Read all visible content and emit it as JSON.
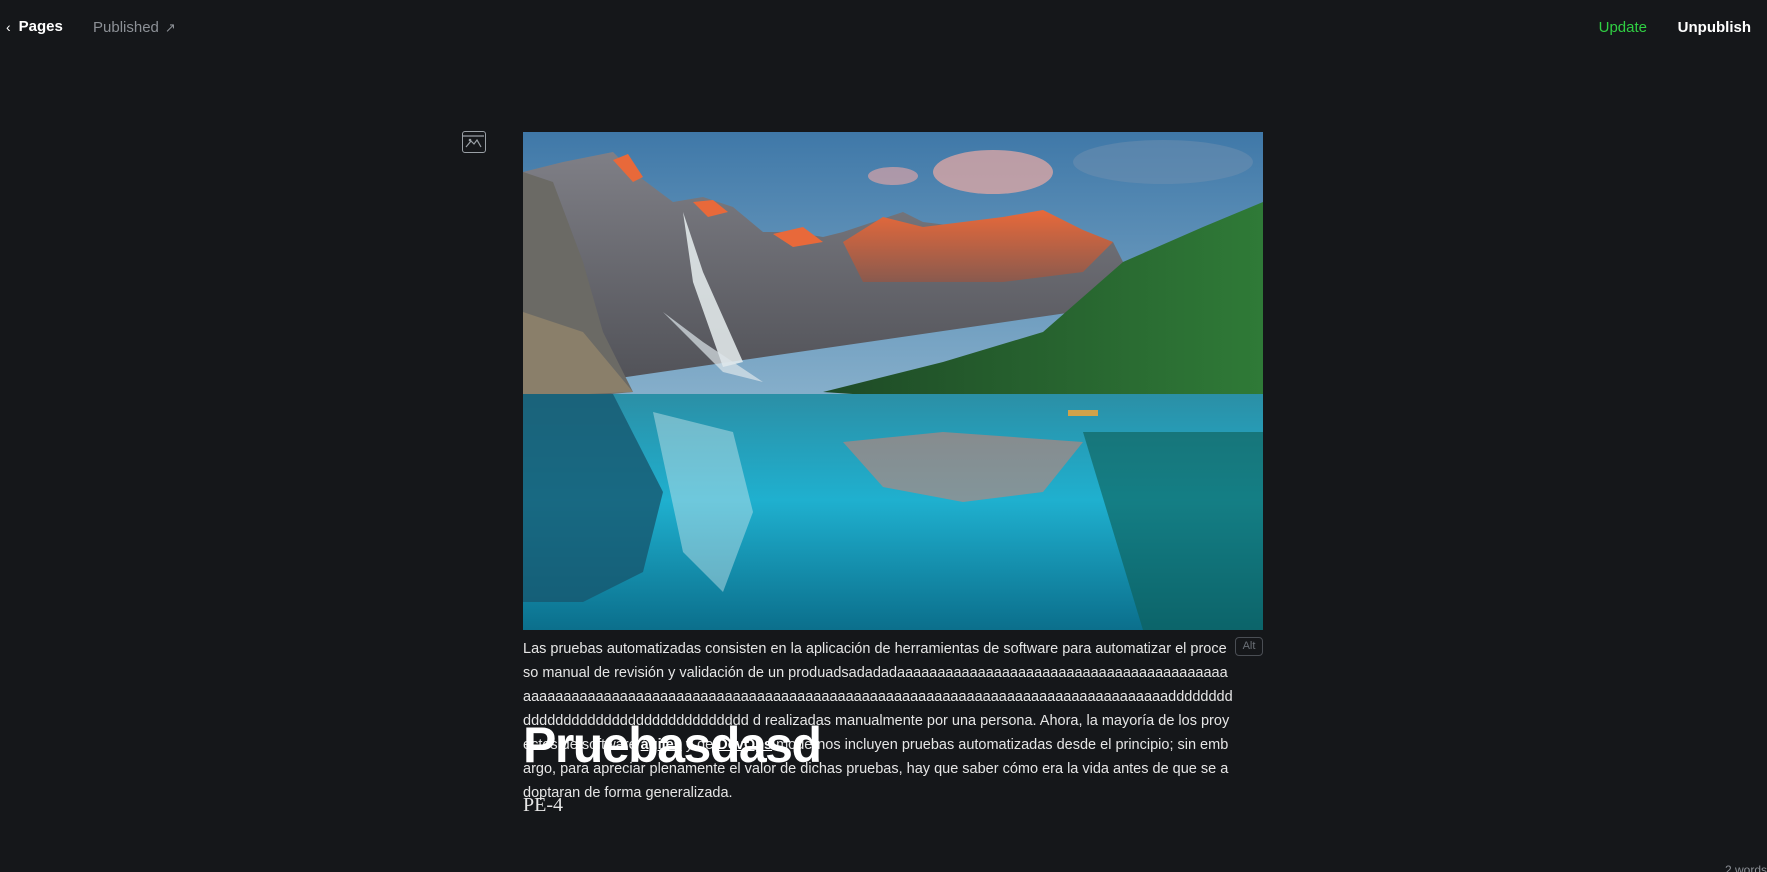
{
  "topbar": {
    "back_label": "Pages",
    "status_label": "Published",
    "update_label": "Update",
    "unpublish_label": "Unpublish"
  },
  "icons": {
    "back": "chevron-left-icon",
    "status_link": "arrow-up-right-icon",
    "card_toggle": "image-card-icon"
  },
  "feature_image": {
    "alt_label": "Alt"
  },
  "caption": {
    "line1": "Las pruebas automatizadas consisten en la aplicación de herramientas de software para automatizar el proceso manual de revisión y validación de un produadsadadadaaaaaaaaaaaaaaaaaaaaaaaaaaaaaaaaaaaaaaaaaaaaaaaaaaaaaaaaaaaaaaaaaaaaaaaaaaaaaaaaaaaaaaaaaaaaaaaaaaaaaaaaaaaaaaaaaaaaaaaaadddddddddddddddddddddddddddddddddddd d realizadas manualmente por una persona. Ahora, la mayoría de los proyectos de software ",
    "link1": "ágiles",
    "mid": " y de ",
    "link2": "DevOps",
    "end": " modernos incluyen pruebas automatizadas desde el principio; sin embargo, para apreciar plenamente el valor de dichas pruebas, hay que saber cómo era la vida antes de que se adoptaran de forma generalizada."
  },
  "post": {
    "title": "Pruebasdasd",
    "excerpt": "PE-4",
    "word_count": "2 words"
  },
  "colors": {
    "background": "#15171a",
    "update": "#30cf43",
    "muted": "#8c9096"
  }
}
